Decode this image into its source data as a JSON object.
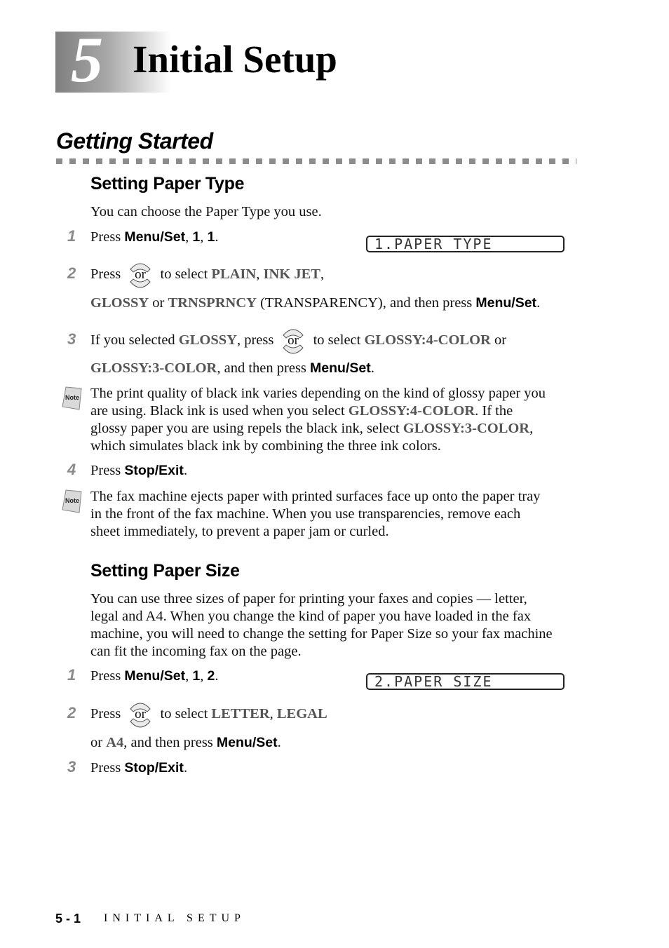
{
  "chapter": {
    "number": "5",
    "title": "Initial Setup"
  },
  "section": {
    "title": "Getting Started"
  },
  "paper_type": {
    "heading": "Setting Paper Type",
    "intro": "You can choose the Paper Type you use.",
    "lcd": "1.PAPER TYPE",
    "steps": [
      {
        "num": "1",
        "press": "Press ",
        "key": "Menu/Set",
        "sep1": ", ",
        "k1": "1",
        "sep2": ", ",
        "k2": "1",
        "end": "."
      },
      {
        "num": "2",
        "press": "Press",
        "or": "or",
        "to_select": "to select ",
        "opt1": "PLAIN",
        "sep1": ", ",
        "opt2": "INK JET",
        "sep2": ",",
        "opt3": "GLOSSY",
        "or_word": " or ",
        "opt4": "TRNSPRNCY",
        "after": " (TRANSPARENCY), and then press ",
        "key": "Menu/Set",
        "end": "."
      },
      {
        "num": "3",
        "lead": "If you selected ",
        "opt_sel": "GLOSSY",
        "press": ", press",
        "or": "or",
        "to_select": "to select ",
        "opt1": "GLOSSY:4-COLOR",
        "or_word": " or",
        "opt2": "GLOSSY:3-COLOR",
        "after": ", and then press ",
        "key": "Menu/Set",
        "end": "."
      },
      {
        "num": "4",
        "press": "Press ",
        "key": "Stop/Exit",
        "end": "."
      }
    ],
    "note1": {
      "icon_label": "Note",
      "line1": "The print quality of black ink varies depending on the kind of glossy paper you",
      "line2a": "are using. Black ink is used when you select ",
      "line2b": "GLOSSY:4-COLOR",
      "line2c": ". If the",
      "line3a": "glossy paper you are using repels the black ink, select ",
      "line3b": "GLOSSY:3-COLOR",
      "line3c": ",",
      "line4": "which simulates black ink by combining the three ink colors."
    },
    "note2": {
      "icon_label": "Note",
      "line1": "The fax machine ejects paper with printed surfaces face up onto the paper tray",
      "line2": "in the front of the fax machine. When you use transparencies, remove each",
      "line3": "sheet immediately, to prevent a paper jam or curled."
    }
  },
  "paper_size": {
    "heading": "Setting Paper Size",
    "intro": [
      "You can use three sizes of paper for printing your faxes and copies — letter,",
      "legal and A4. When you change the kind of paper you have loaded in the fax",
      "machine, you will need to change the setting for Paper Size so your fax machine",
      "can fit the incoming fax on the page."
    ],
    "lcd": "2.PAPER SIZE",
    "steps": [
      {
        "num": "1",
        "press": "Press ",
        "key": "Menu/Set",
        "sep1": ", ",
        "k1": "1",
        "sep2": ", ",
        "k2": "2",
        "end": "."
      },
      {
        "num": "2",
        "press": "Press",
        "or": "or",
        "to_select": "to select ",
        "opt1": "LETTER",
        "sep1": ", ",
        "opt2": "LEGAL",
        "or_word": "or ",
        "opt3": "A4",
        "after": ", and then press ",
        "key": "Menu/Set",
        "end": "."
      },
      {
        "num": "3",
        "press": "Press ",
        "key": "Stop/Exit",
        "end": "."
      }
    ]
  },
  "footer": {
    "page_number": "5 - 1",
    "chapter_title": "INITIAL SETUP"
  }
}
